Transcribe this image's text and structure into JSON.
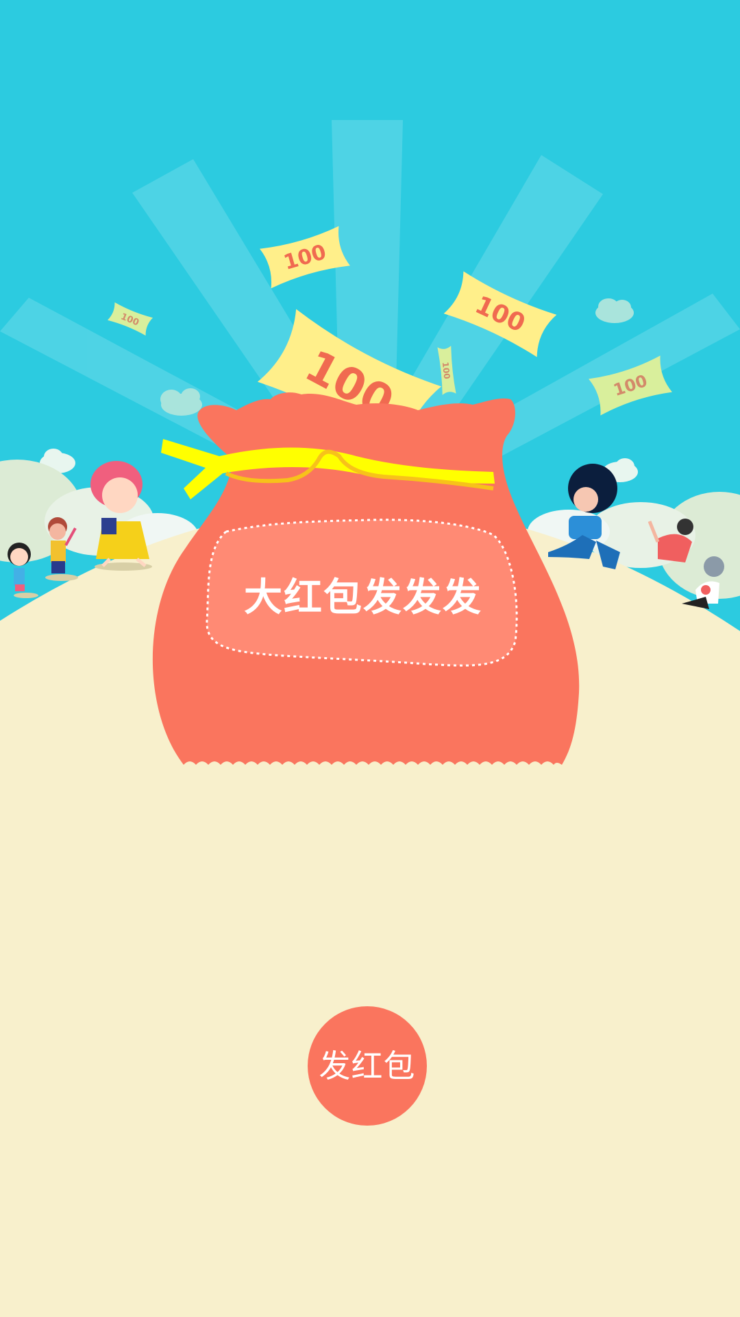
{
  "banner": {
    "title": "大红包发发发"
  },
  "bills": [
    {
      "amount": "100"
    },
    {
      "amount": "100"
    },
    {
      "amount": "100"
    },
    {
      "amount": "100"
    },
    {
      "amount": "100"
    },
    {
      "amount": "100"
    }
  ],
  "actions": {
    "send_label": "发红包"
  },
  "colors": {
    "sky": "#2ccbe0",
    "ground": "#f8f0cc",
    "bag": "#fa755e",
    "bag_panel": "#ff8a74",
    "ribbon": "#ffff00",
    "bill": "#ffef8a",
    "bill_text": "#f06a50",
    "button": "#fa755e"
  },
  "icons": {
    "bag": "money-bag-icon",
    "bill": "banknote-icon",
    "cloud": "cloud-icon",
    "character": "cartoon-person-icon"
  }
}
